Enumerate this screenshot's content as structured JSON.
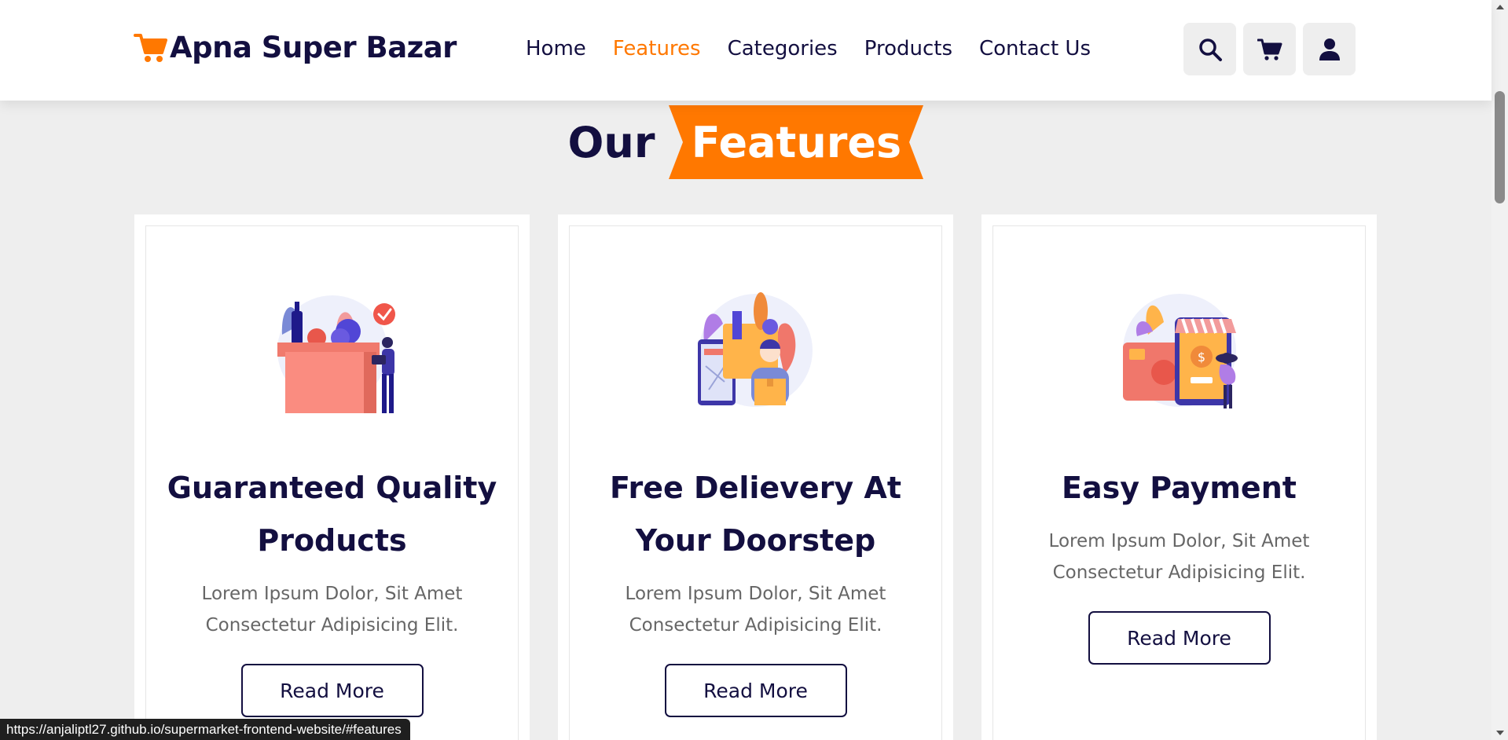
{
  "header": {
    "brand": "Apna Super Bazar",
    "nav": [
      {
        "label": "Home",
        "active": false
      },
      {
        "label": "Features",
        "active": true
      },
      {
        "label": "Categories",
        "active": false
      },
      {
        "label": "Products",
        "active": false
      },
      {
        "label": "Contact Us",
        "active": false
      }
    ],
    "icons": [
      "search-icon",
      "cart-icon",
      "user-icon"
    ]
  },
  "section": {
    "heading_plain": "Our",
    "heading_highlight": "Features"
  },
  "features": [
    {
      "title": "Guaranteed Quality Products",
      "description": "Lorem Ipsum Dolor, Sit Amet Consectetur Adipisicing Elit.",
      "button": "Read More",
      "illustration": "grocery-box-illustration"
    },
    {
      "title": "Free Delievery At Your Doorstep",
      "description": "Lorem Ipsum Dolor, Sit Amet Consectetur Adipisicing Elit.",
      "button": "Read More",
      "illustration": "delivery-illustration"
    },
    {
      "title": "Easy Payment",
      "description": "Lorem Ipsum Dolor, Sit Amet Consectetur Adipisicing Elit.",
      "button": "Read More",
      "illustration": "payment-illustration"
    }
  ],
  "status_bar": {
    "url": "https://anjaliptl27.github.io/supermarket-frontend-website/#features"
  },
  "colors": {
    "accent": "#ff7800",
    "text_dark": "#130f40",
    "text_muted": "#666666",
    "background": "#eeeeee"
  }
}
